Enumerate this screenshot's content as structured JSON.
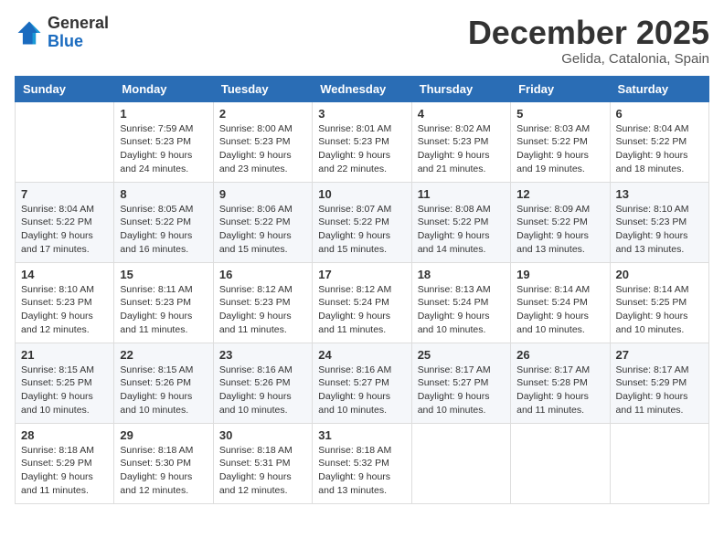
{
  "header": {
    "logo_general": "General",
    "logo_blue": "Blue",
    "month_title": "December 2025",
    "location": "Gelida, Catalonia, Spain"
  },
  "weekdays": [
    "Sunday",
    "Monday",
    "Tuesday",
    "Wednesday",
    "Thursday",
    "Friday",
    "Saturday"
  ],
  "weeks": [
    [
      {
        "day": "",
        "info": ""
      },
      {
        "day": "1",
        "info": "Sunrise: 7:59 AM\nSunset: 5:23 PM\nDaylight: 9 hours\nand 24 minutes."
      },
      {
        "day": "2",
        "info": "Sunrise: 8:00 AM\nSunset: 5:23 PM\nDaylight: 9 hours\nand 23 minutes."
      },
      {
        "day": "3",
        "info": "Sunrise: 8:01 AM\nSunset: 5:23 PM\nDaylight: 9 hours\nand 22 minutes."
      },
      {
        "day": "4",
        "info": "Sunrise: 8:02 AM\nSunset: 5:23 PM\nDaylight: 9 hours\nand 21 minutes."
      },
      {
        "day": "5",
        "info": "Sunrise: 8:03 AM\nSunset: 5:22 PM\nDaylight: 9 hours\nand 19 minutes."
      },
      {
        "day": "6",
        "info": "Sunrise: 8:04 AM\nSunset: 5:22 PM\nDaylight: 9 hours\nand 18 minutes."
      }
    ],
    [
      {
        "day": "7",
        "info": "Sunrise: 8:04 AM\nSunset: 5:22 PM\nDaylight: 9 hours\nand 17 minutes."
      },
      {
        "day": "8",
        "info": "Sunrise: 8:05 AM\nSunset: 5:22 PM\nDaylight: 9 hours\nand 16 minutes."
      },
      {
        "day": "9",
        "info": "Sunrise: 8:06 AM\nSunset: 5:22 PM\nDaylight: 9 hours\nand 15 minutes."
      },
      {
        "day": "10",
        "info": "Sunrise: 8:07 AM\nSunset: 5:22 PM\nDaylight: 9 hours\nand 15 minutes."
      },
      {
        "day": "11",
        "info": "Sunrise: 8:08 AM\nSunset: 5:22 PM\nDaylight: 9 hours\nand 14 minutes."
      },
      {
        "day": "12",
        "info": "Sunrise: 8:09 AM\nSunset: 5:22 PM\nDaylight: 9 hours\nand 13 minutes."
      },
      {
        "day": "13",
        "info": "Sunrise: 8:10 AM\nSunset: 5:23 PM\nDaylight: 9 hours\nand 13 minutes."
      }
    ],
    [
      {
        "day": "14",
        "info": "Sunrise: 8:10 AM\nSunset: 5:23 PM\nDaylight: 9 hours\nand 12 minutes."
      },
      {
        "day": "15",
        "info": "Sunrise: 8:11 AM\nSunset: 5:23 PM\nDaylight: 9 hours\nand 11 minutes."
      },
      {
        "day": "16",
        "info": "Sunrise: 8:12 AM\nSunset: 5:23 PM\nDaylight: 9 hours\nand 11 minutes."
      },
      {
        "day": "17",
        "info": "Sunrise: 8:12 AM\nSunset: 5:24 PM\nDaylight: 9 hours\nand 11 minutes."
      },
      {
        "day": "18",
        "info": "Sunrise: 8:13 AM\nSunset: 5:24 PM\nDaylight: 9 hours\nand 10 minutes."
      },
      {
        "day": "19",
        "info": "Sunrise: 8:14 AM\nSunset: 5:24 PM\nDaylight: 9 hours\nand 10 minutes."
      },
      {
        "day": "20",
        "info": "Sunrise: 8:14 AM\nSunset: 5:25 PM\nDaylight: 9 hours\nand 10 minutes."
      }
    ],
    [
      {
        "day": "21",
        "info": "Sunrise: 8:15 AM\nSunset: 5:25 PM\nDaylight: 9 hours\nand 10 minutes."
      },
      {
        "day": "22",
        "info": "Sunrise: 8:15 AM\nSunset: 5:26 PM\nDaylight: 9 hours\nand 10 minutes."
      },
      {
        "day": "23",
        "info": "Sunrise: 8:16 AM\nSunset: 5:26 PM\nDaylight: 9 hours\nand 10 minutes."
      },
      {
        "day": "24",
        "info": "Sunrise: 8:16 AM\nSunset: 5:27 PM\nDaylight: 9 hours\nand 10 minutes."
      },
      {
        "day": "25",
        "info": "Sunrise: 8:17 AM\nSunset: 5:27 PM\nDaylight: 9 hours\nand 10 minutes."
      },
      {
        "day": "26",
        "info": "Sunrise: 8:17 AM\nSunset: 5:28 PM\nDaylight: 9 hours\nand 11 minutes."
      },
      {
        "day": "27",
        "info": "Sunrise: 8:17 AM\nSunset: 5:29 PM\nDaylight: 9 hours\nand 11 minutes."
      }
    ],
    [
      {
        "day": "28",
        "info": "Sunrise: 8:18 AM\nSunset: 5:29 PM\nDaylight: 9 hours\nand 11 minutes."
      },
      {
        "day": "29",
        "info": "Sunrise: 8:18 AM\nSunset: 5:30 PM\nDaylight: 9 hours\nand 12 minutes."
      },
      {
        "day": "30",
        "info": "Sunrise: 8:18 AM\nSunset: 5:31 PM\nDaylight: 9 hours\nand 12 minutes."
      },
      {
        "day": "31",
        "info": "Sunrise: 8:18 AM\nSunset: 5:32 PM\nDaylight: 9 hours\nand 13 minutes."
      },
      {
        "day": "",
        "info": ""
      },
      {
        "day": "",
        "info": ""
      },
      {
        "day": "",
        "info": ""
      }
    ]
  ]
}
